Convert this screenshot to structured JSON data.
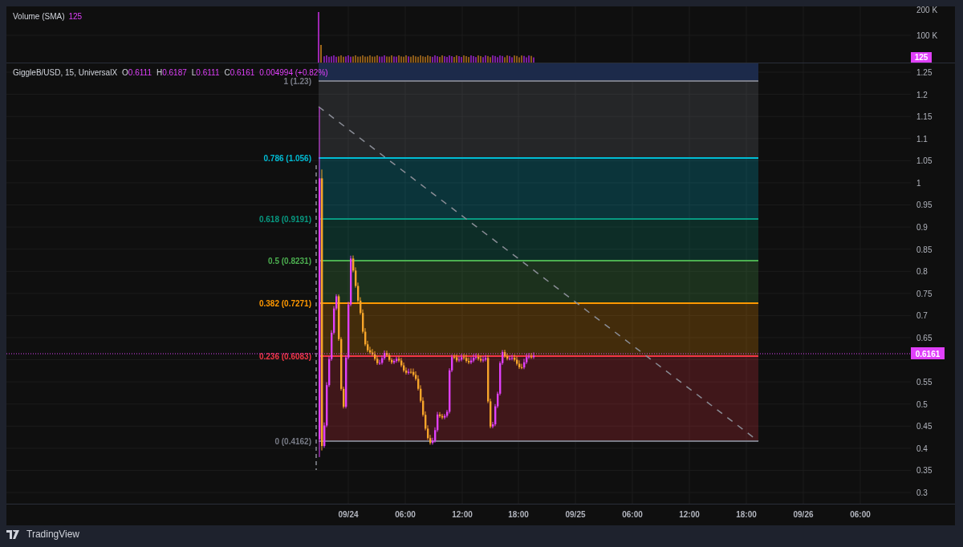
{
  "volume_legend": {
    "title": "Volume (SMA)",
    "value": "125"
  },
  "volume_axis": {
    "ticks": [
      "200 K",
      "100 K"
    ],
    "badge": "125"
  },
  "legend": {
    "symbol": "GiggleB/USD, 15, UniversalX",
    "values": [
      {
        "label": "O",
        "value": "0.6111"
      },
      {
        "label": "H",
        "value": "0.6187"
      },
      {
        "label": "L",
        "value": "0.6111"
      },
      {
        "label": "C",
        "value": "0.6161"
      }
    ],
    "change": "0.004994 (+0.82%)"
  },
  "fib_levels": [
    {
      "label": "1 (1.23)",
      "color": "#787b86"
    },
    {
      "label": "0.786 (1.056)",
      "color": "#00bcd4"
    },
    {
      "label": "0.618 (0.9191)",
      "color": "#089981"
    },
    {
      "label": "0.5 (0.8231)",
      "color": "#4caf50"
    },
    {
      "label": "0.382 (0.7271)",
      "color": "#ff9800"
    },
    {
      "label": "0.236 (0.6083)",
      "color": "#f23645"
    },
    {
      "label": "0 (0.4162)",
      "color": "#787b86"
    }
  ],
  "price_axis": {
    "ticks": [
      "1.25",
      "1.2",
      "1.15",
      "1.1",
      "1.05",
      "1",
      "0.95",
      "0.9",
      "0.85",
      "0.8",
      "0.75",
      "0.7",
      "0.65",
      "0.55",
      "0.5",
      "0.45",
      "0.4",
      "0.35",
      "0.3"
    ],
    "last_price": "0.6161"
  },
  "time_axis": {
    "ticks": [
      "09/24",
      "06:00",
      "12:00",
      "18:00",
      "09/25",
      "06:00",
      "12:00",
      "18:00",
      "09/26",
      "06:00"
    ]
  },
  "footer": {
    "brand": "TradingView"
  }
}
